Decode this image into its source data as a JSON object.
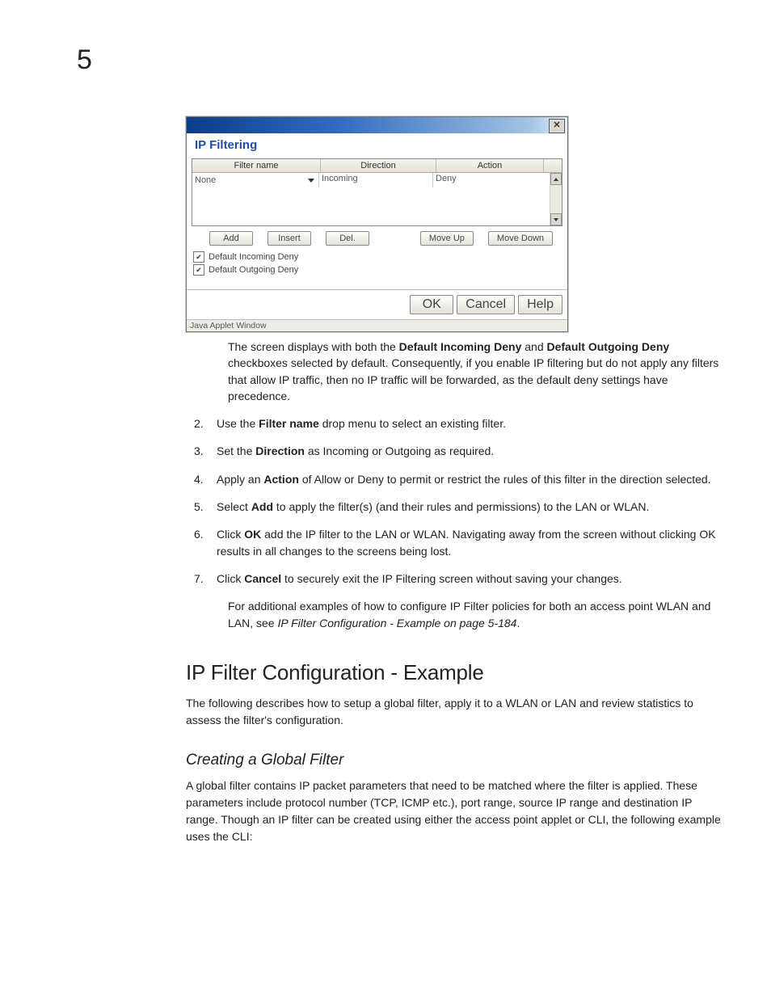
{
  "chapter": "5",
  "applet": {
    "close_glyph": "✕",
    "title": "IP Filtering",
    "headers": {
      "filter_name": "Filter name",
      "direction": "Direction",
      "action": "Action"
    },
    "row0": {
      "filter_name": "None",
      "direction": "Incoming",
      "action": "Deny"
    },
    "buttons": {
      "add": "Add",
      "insert": "Insert",
      "del": "Del.",
      "move_up": "Move Up",
      "move_down": "Move Down",
      "ok": "OK",
      "cancel": "Cancel",
      "help": "Help"
    },
    "checkboxes": {
      "incoming": "Default Incoming Deny",
      "outgoing": "Default Outgoing Deny"
    },
    "status": "Java Applet Window"
  },
  "p_after_fig_1": "The screen displays with both the ",
  "p_after_fig_b1": "Default Incoming Deny",
  "p_after_fig_2": " and ",
  "p_after_fig_b2": "Default Outgoing Deny",
  "p_after_fig_3": " checkboxes selected by default. Consequently, if you enable IP filtering but do not apply any filters that allow IP traffic, then no IP traffic will be forwarded, as the default deny settings have precedence.",
  "steps": {
    "n2": "2.",
    "t2a": "Use the ",
    "t2b": "Filter name",
    "t2c": " drop menu to select an existing filter.",
    "n3": "3.",
    "t3a": "Set the ",
    "t3b": "Direction",
    "t3c": " as Incoming or Outgoing as required.",
    "n4": "4.",
    "t4a": "Apply an ",
    "t4b": "Action",
    "t4c": " of Allow or Deny to permit or restrict the rules of this filter in the direction selected.",
    "n5": "5.",
    "t5a": "Select ",
    "t5b": "Add",
    "t5c": " to apply the filter(s) (and their rules and permissions) to the LAN or WLAN.",
    "n6": "6.",
    "t6a": "Click ",
    "t6b": "OK",
    "t6c": " add the IP filter to the LAN or WLAN. Navigating away from the screen without clicking OK results in all changes to the screens being lost.",
    "n7": "7.",
    "t7a": "Click ",
    "t7b": "Cancel",
    "t7c": " to securely exit the IP Filtering screen without saving your changes."
  },
  "sub_p1": "For additional examples of how to configure IP Filter policies for both an access point WLAN and LAN, see ",
  "sub_p1_i": "IP Filter Configuration - Example on page 5-184",
  "sub_p1_end": ".",
  "h2": "IP Filter Configuration - Example",
  "h2_body": "The following describes how to setup a global filter, apply it to a WLAN or LAN and review statistics to assess the filter's configuration.",
  "h3": "Creating a Global Filter",
  "h3_body": "A global filter contains IP packet parameters that need to be matched where the filter is applied. These parameters include protocol number (TCP, ICMP etc.), port range, source IP range and destination IP range. Though an IP filter can be created using either the access point applet or CLI, the following example uses the CLI:"
}
